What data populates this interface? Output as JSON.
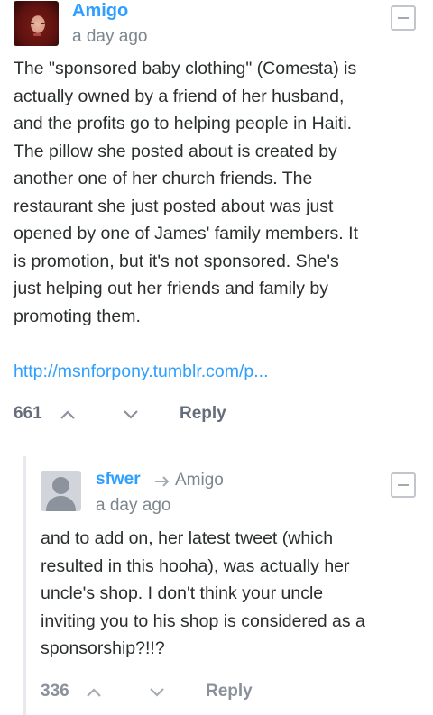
{
  "comment1": {
    "author": "Amigo",
    "time": "a day ago",
    "lines": [
      "The \"sponsored baby clothing\" (Comesta) is",
      "actually owned by a friend of her husband,",
      "and the profits go to helping people in Haiti.",
      "The pillow she posted about is created by",
      "another one of her church friends. The",
      "restaurant she just posted about was just",
      "opened by one of James' family members. It",
      "is promotion, but it's not sponsored. She's",
      "just helping out her friends and family by",
      "promoting them."
    ],
    "link": "http://msnforpony.tumblr.com/p...",
    "votes": "661",
    "reply_label": "Reply"
  },
  "comment2": {
    "author": "sfwer",
    "parent": "Amigo",
    "time": "a day ago",
    "lines": [
      "and to add on, her latest tweet (which",
      "resulted in this hooha), was actually her",
      "uncle's shop. I don't think your uncle",
      "inviting you to his shop is considered as a",
      "sponsorship?!!?"
    ],
    "votes": "336",
    "reply_label": "Reply"
  },
  "icons": {
    "collapse": "minus-box-icon",
    "upvote": "chevron-up-icon",
    "downvote": "chevron-down-icon",
    "in_reply_to": "arrow-right-icon"
  },
  "colors": {
    "accent": "#2e9fff",
    "muted": "#7c868c",
    "text": "#2a2e2e"
  }
}
